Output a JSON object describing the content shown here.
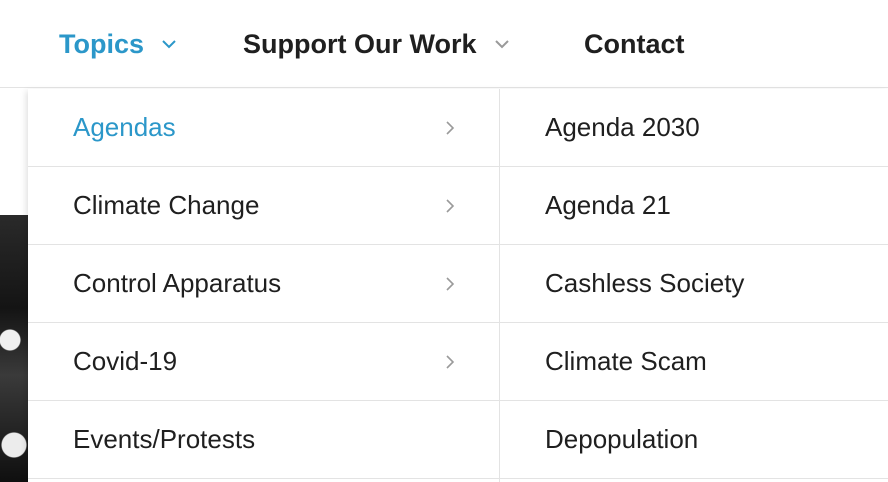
{
  "nav": {
    "items": [
      {
        "label": "Topics",
        "active": true,
        "has_dropdown": true
      },
      {
        "label": "Support Our Work",
        "active": false,
        "has_dropdown": true
      },
      {
        "label": "Contact",
        "active": false,
        "has_dropdown": false
      }
    ]
  },
  "dropdown": {
    "categories": [
      {
        "label": "Agendas",
        "active": true,
        "has_submenu": true
      },
      {
        "label": "Climate Change",
        "active": false,
        "has_submenu": true
      },
      {
        "label": "Control Apparatus",
        "active": false,
        "has_submenu": true
      },
      {
        "label": "Covid-19",
        "active": false,
        "has_submenu": true
      },
      {
        "label": "Events/Protests",
        "active": false,
        "has_submenu": false
      }
    ],
    "subitems": [
      {
        "label": "Agenda 2030"
      },
      {
        "label": "Agenda 21"
      },
      {
        "label": "Cashless Society"
      },
      {
        "label": "Climate Scam"
      },
      {
        "label": "Depopulation"
      }
    ]
  },
  "colors": {
    "accent": "#2b97c9",
    "text": "#1f1f1f",
    "divider": "#e3e3e3",
    "chevron": "#9a9a9a"
  },
  "icons": {
    "nav_dropdown": "chevron-down-icon",
    "submenu": "chevron-right-icon"
  }
}
